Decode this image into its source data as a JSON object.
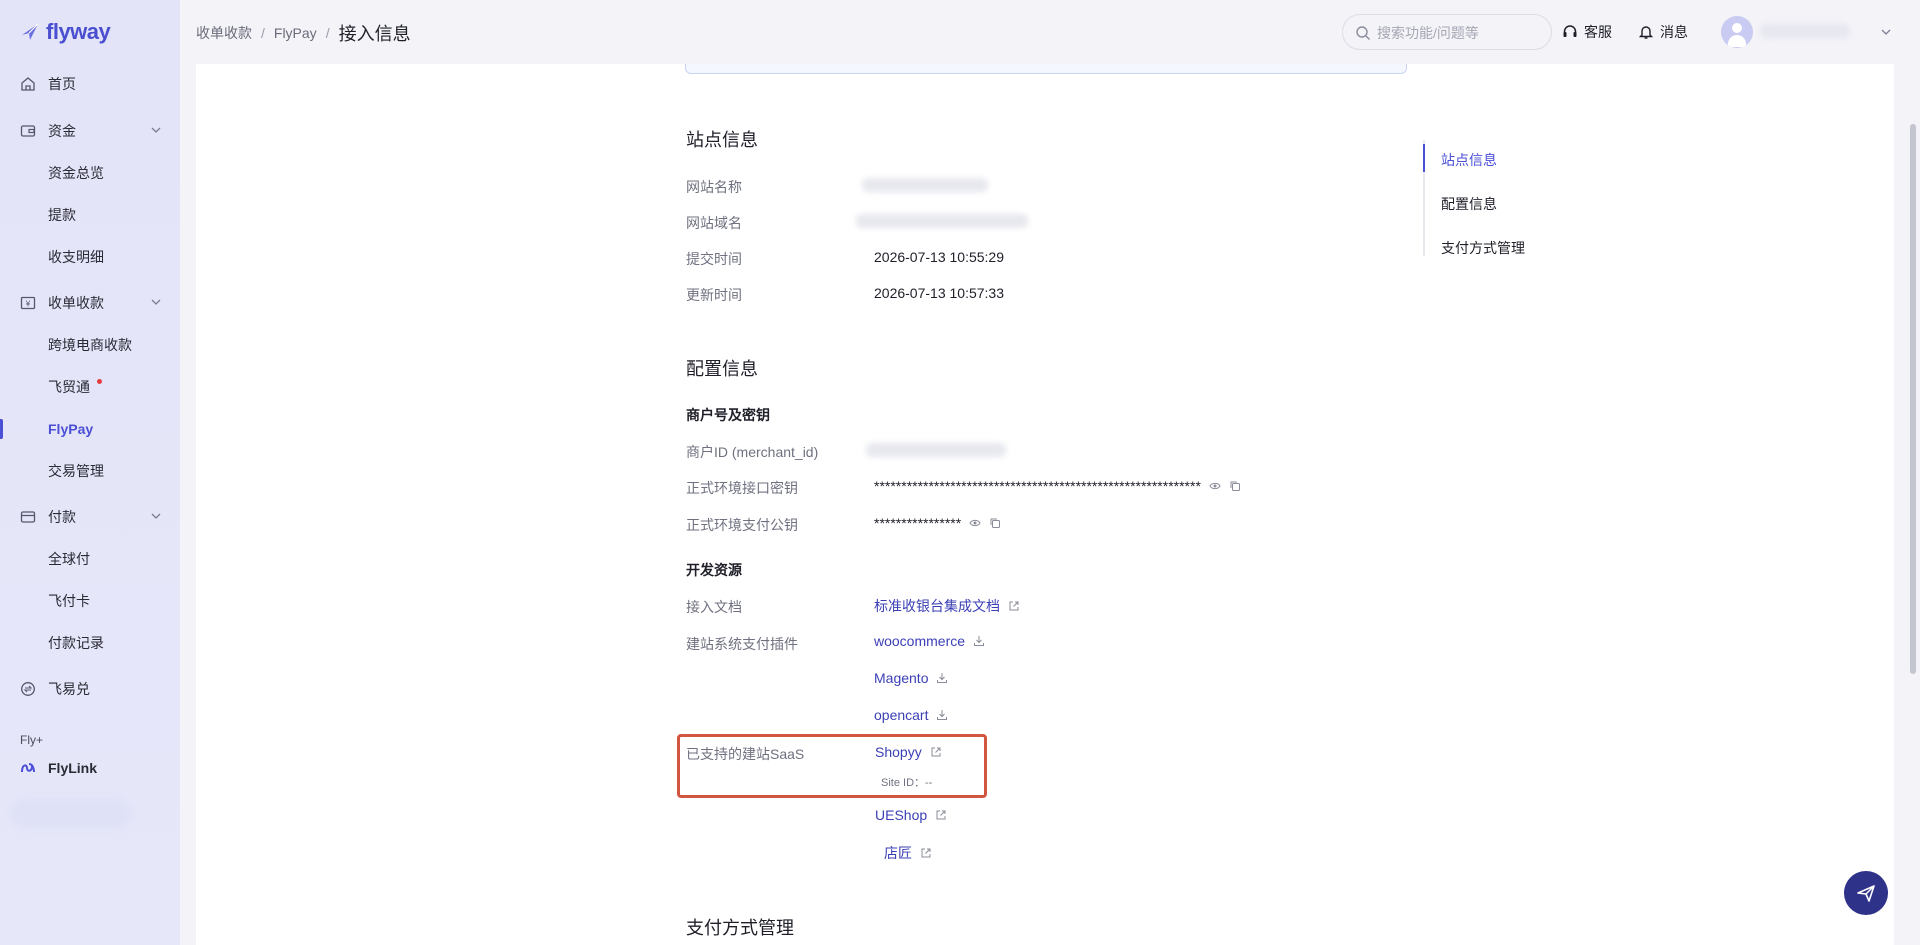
{
  "app": {
    "logo_text": "flyway",
    "brand_color": "#4b4fd6"
  },
  "sidebar": {
    "items": [
      {
        "label": "首页",
        "icon": "home-icon"
      },
      {
        "label": "资金",
        "icon": "wallet-icon"
      },
      {
        "label": "资金总览"
      },
      {
        "label": "提款"
      },
      {
        "label": "收支明细"
      },
      {
        "label": "收单收款",
        "icon": "receipt-icon"
      },
      {
        "label": "跨境电商收款"
      },
      {
        "label": "飞贸通"
      },
      {
        "label": "FlyPay"
      },
      {
        "label": "交易管理"
      },
      {
        "label": "付款",
        "icon": "card-icon"
      },
      {
        "label": "全球付"
      },
      {
        "label": "飞付卡"
      },
      {
        "label": "付款记录"
      },
      {
        "label": "飞易兑",
        "icon": "exchange-icon"
      }
    ],
    "section_label": "Fly+",
    "flylink_label": "FlyLink"
  },
  "header": {
    "breadcrumb": [
      "收单收款",
      "FlyPay",
      "接入信息"
    ],
    "search_placeholder": "搜索功能/问题等",
    "service_label": "客服",
    "message_label": "消息"
  },
  "site_info": {
    "title": "站点信息",
    "site_name_label": "网站名称",
    "domain_label": "网站域名",
    "submit_time_label": "提交时间",
    "submit_time": "2026-07-13 10:55:29",
    "update_time_label": "更新时间",
    "update_time": "2026-07-13 10:57:33"
  },
  "config_info": {
    "title": "配置信息",
    "merchant_section": "商户号及密钥",
    "merchant_id_label": "商户ID (merchant_id)",
    "api_key_label": "正式环境接口密钥",
    "api_key_value": "************************************************************",
    "public_key_label": "正式环境支付公钥",
    "public_key_value": "****************",
    "dev_section": "开发资源",
    "doc_label": "接入文档",
    "doc_link": "标准收银台集成文档",
    "plugin_label": "建站系统支付插件",
    "plugins": [
      "woocommerce",
      "Magento",
      "opencart"
    ],
    "saas_label": "已支持的建站SaaS",
    "saas": [
      "Shopyy",
      "UEShop",
      "店匠"
    ],
    "site_id_text": "Site ID：--"
  },
  "payment_methods": {
    "title": "支付方式管理"
  },
  "anchor_nav": [
    "站点信息",
    "配置信息",
    "支付方式管理"
  ]
}
